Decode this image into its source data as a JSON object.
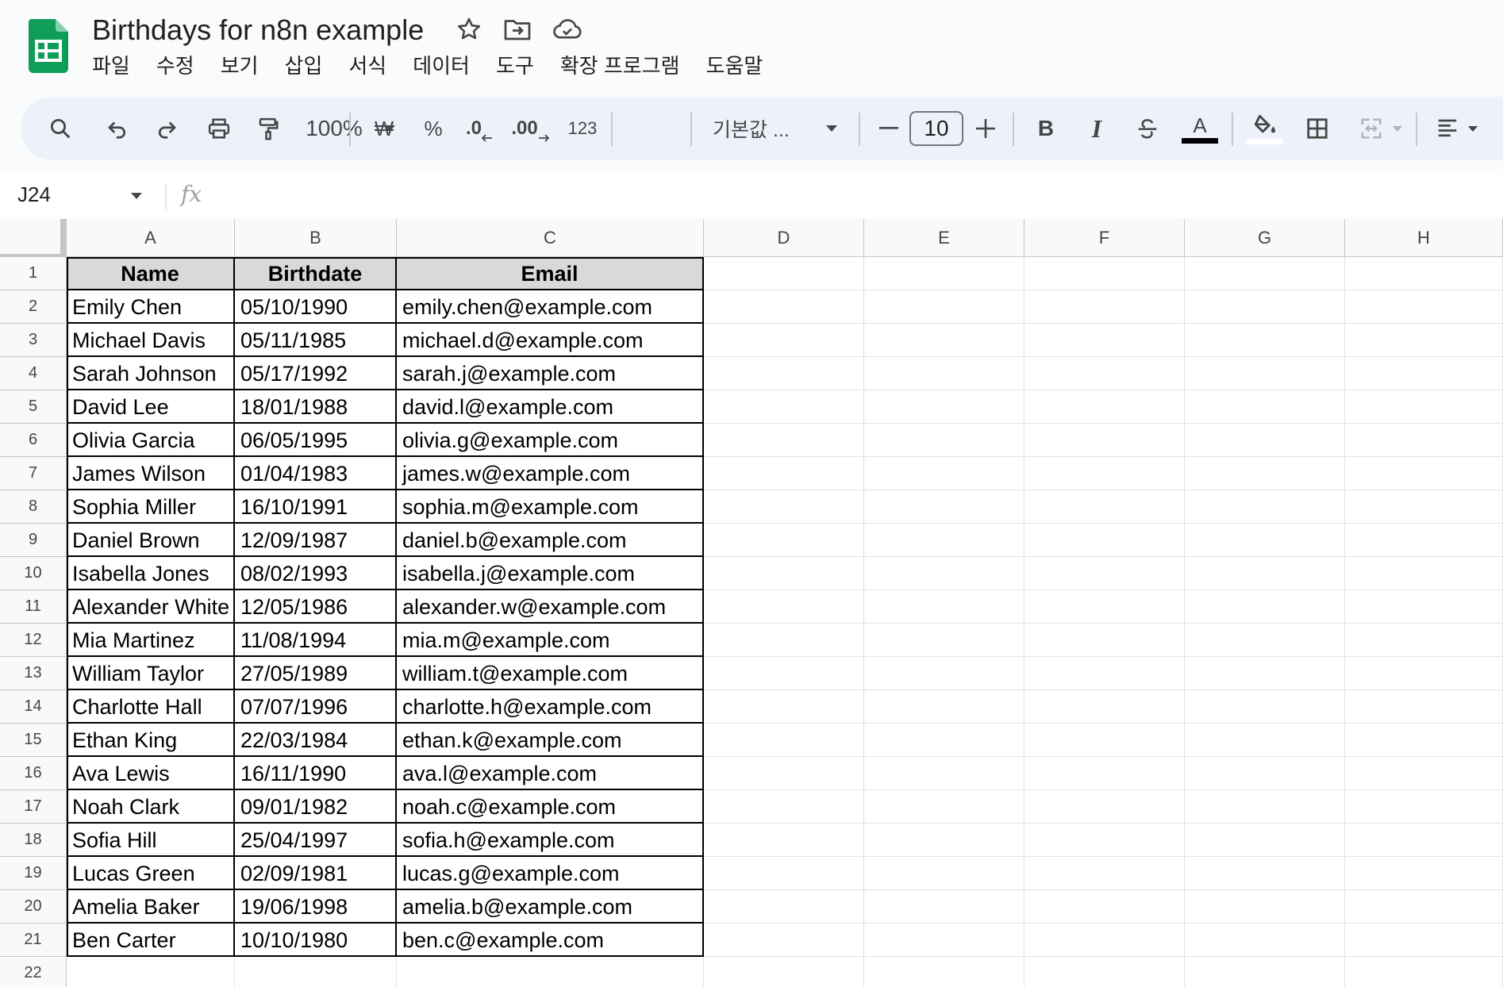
{
  "app": {
    "title": "Birthdays for n8n example",
    "menu": [
      "파일",
      "수정",
      "보기",
      "삽입",
      "서식",
      "데이터",
      "도구",
      "확장 프로그램",
      "도움말"
    ]
  },
  "toolbar": {
    "zoom": "100%",
    "currency": "₩",
    "percent": "%",
    "decrease_decimal": ".0",
    "increase_decimal": ".00",
    "number_format": "123",
    "font": "기본값 ...",
    "font_size": "10",
    "bold": "B",
    "italic": "I",
    "text_color_glyph": "A",
    "colors": {
      "brand_green": "#0f9d58",
      "text_color_bar": "#000000"
    }
  },
  "formula_bar": {
    "cell_ref": "J24",
    "fx": "fx",
    "value": ""
  },
  "sheet": {
    "columns": [
      "A",
      "B",
      "C",
      "D",
      "E",
      "F",
      "G",
      "H"
    ],
    "row_numbers": [
      "1",
      "2",
      "3",
      "4",
      "5",
      "6",
      "7",
      "8",
      "9",
      "10",
      "11",
      "12",
      "13",
      "14",
      "15",
      "16",
      "17",
      "18",
      "19",
      "20",
      "21",
      "22"
    ],
    "header": [
      "Name",
      "Birthdate",
      "Email"
    ],
    "rows": [
      [
        "Emily Chen",
        "05/10/1990",
        "emily.chen@example.com"
      ],
      [
        "Michael Davis",
        "05/11/1985",
        "michael.d@example.com"
      ],
      [
        "Sarah Johnson",
        "05/17/1992",
        "sarah.j@example.com"
      ],
      [
        "David Lee",
        "18/01/1988",
        "david.l@example.com"
      ],
      [
        "Olivia Garcia",
        "06/05/1995",
        "olivia.g@example.com"
      ],
      [
        "James Wilson",
        "01/04/1983",
        "james.w@example.com"
      ],
      [
        "Sophia Miller",
        "16/10/1991",
        "sophia.m@example.com"
      ],
      [
        "Daniel Brown",
        "12/09/1987",
        "daniel.b@example.com"
      ],
      [
        "Isabella Jones",
        "08/02/1993",
        "isabella.j@example.com"
      ],
      [
        "Alexander White",
        "12/05/1986",
        "alexander.w@example.com"
      ],
      [
        "Mia Martinez",
        "11/08/1994",
        "mia.m@example.com"
      ],
      [
        "William Taylor",
        "27/05/1989",
        "william.t@example.com"
      ],
      [
        "Charlotte Hall",
        "07/07/1996",
        "charlotte.h@example.com"
      ],
      [
        "Ethan King",
        "22/03/1984",
        "ethan.k@example.com"
      ],
      [
        "Ava Lewis",
        "16/11/1990",
        "ava.l@example.com"
      ],
      [
        "Noah Clark",
        "09/01/1982",
        "noah.c@example.com"
      ],
      [
        "Sofia Hill",
        "25/04/1997",
        "sofia.h@example.com"
      ],
      [
        "Lucas Green",
        "02/09/1981",
        "lucas.g@example.com"
      ],
      [
        "Amelia Baker",
        "19/06/1998",
        "amelia.b@example.com"
      ],
      [
        "Ben Carter",
        "10/10/1980",
        "ben.c@example.com"
      ]
    ]
  }
}
